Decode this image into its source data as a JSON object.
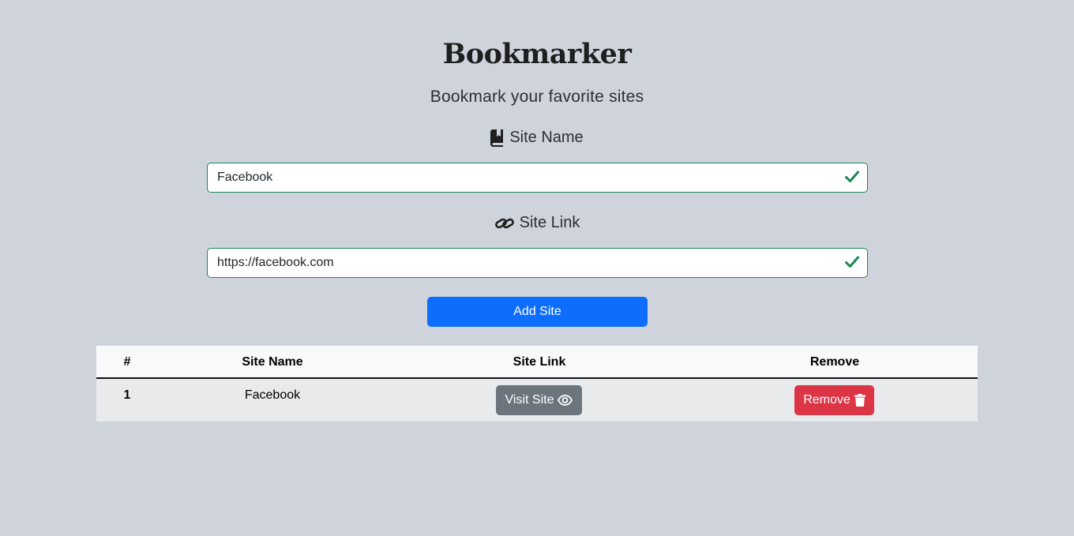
{
  "header": {
    "title": "Bookmarker",
    "subtitle": "Bookmark your favorite sites"
  },
  "form": {
    "site_name_label": "Site Name",
    "site_name_value": "Facebook",
    "site_link_label": "Site Link",
    "site_link_value": "https://facebook.com",
    "add_button": "Add Site"
  },
  "table": {
    "headers": [
      "#",
      "Site Name",
      "Site Link",
      "Remove"
    ],
    "rows": [
      {
        "index": "1",
        "name": "Facebook",
        "visit_label": "Visit Site",
        "remove_label": "Remove"
      }
    ]
  },
  "colors": {
    "background": "#cfd4dc",
    "valid_border": "#198754",
    "primary": "#0d6efd",
    "secondary": "#6c757d",
    "danger": "#dc3545"
  },
  "icons": {
    "site_name": "book-icon",
    "site_link": "link-icon",
    "valid": "check-icon",
    "visit": "eye-icon",
    "remove": "trash-icon"
  }
}
